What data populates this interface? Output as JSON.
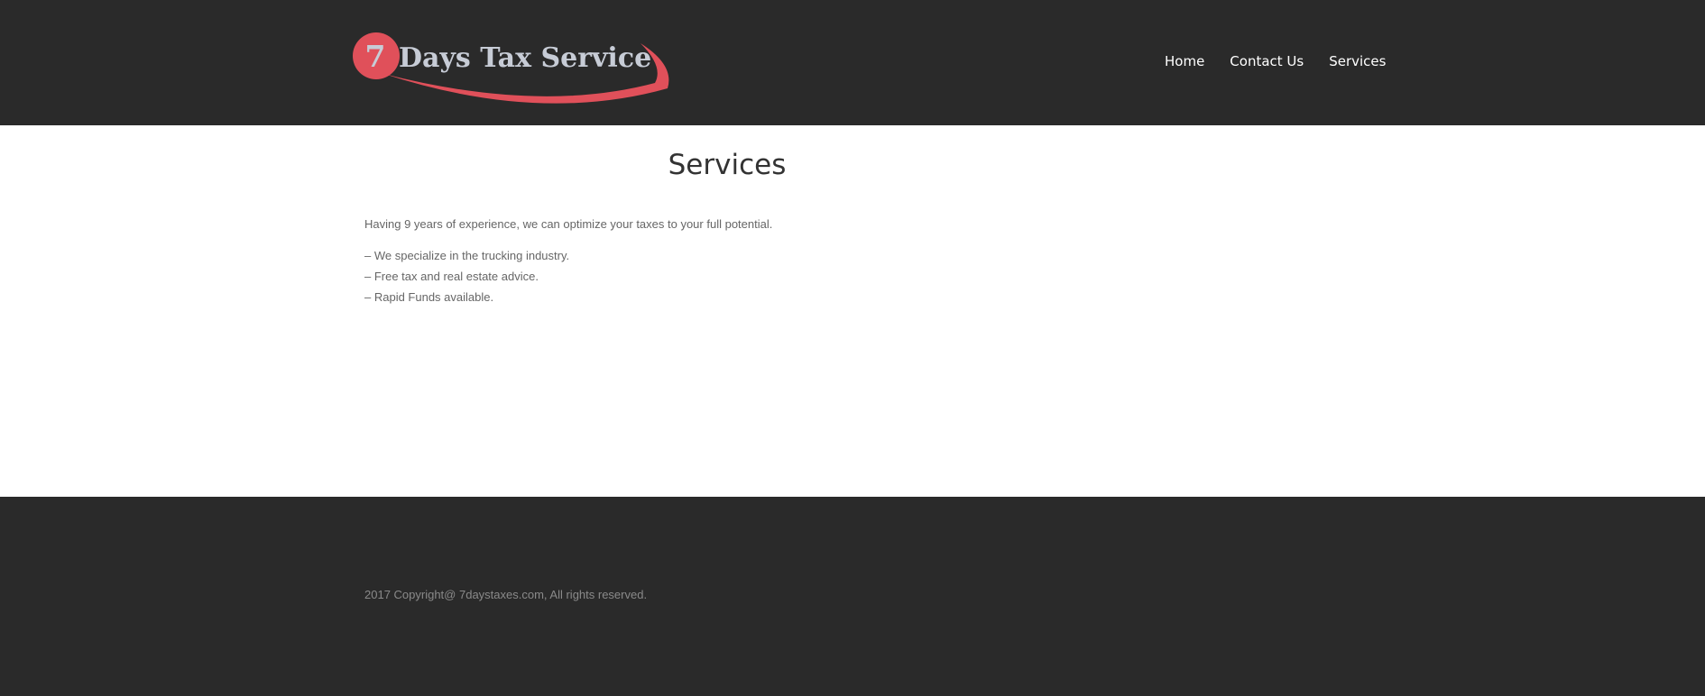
{
  "header": {
    "logo": {
      "numeral": "7",
      "text": "Days Tax Service"
    },
    "nav": [
      {
        "label": "Home"
      },
      {
        "label": "Contact Us"
      },
      {
        "label": "Services"
      }
    ]
  },
  "main": {
    "title": "Services",
    "intro": "Having 9 years of experience, we can optimize your taxes to your full potential.",
    "features": [
      "– We specialize in the trucking industry.",
      "– Free tax and real estate advice.",
      "– Rapid Funds available."
    ]
  },
  "footer": {
    "copyright": "2017 Copyright@ 7daystaxes.com, All rights reserved."
  },
  "colors": {
    "header_bg": "#2a2a2a",
    "footer_bg": "#2a2a2a",
    "logo_accent": "#e0505a",
    "logo_text": "#c7ccd6",
    "nav_text": "#ffffff"
  }
}
